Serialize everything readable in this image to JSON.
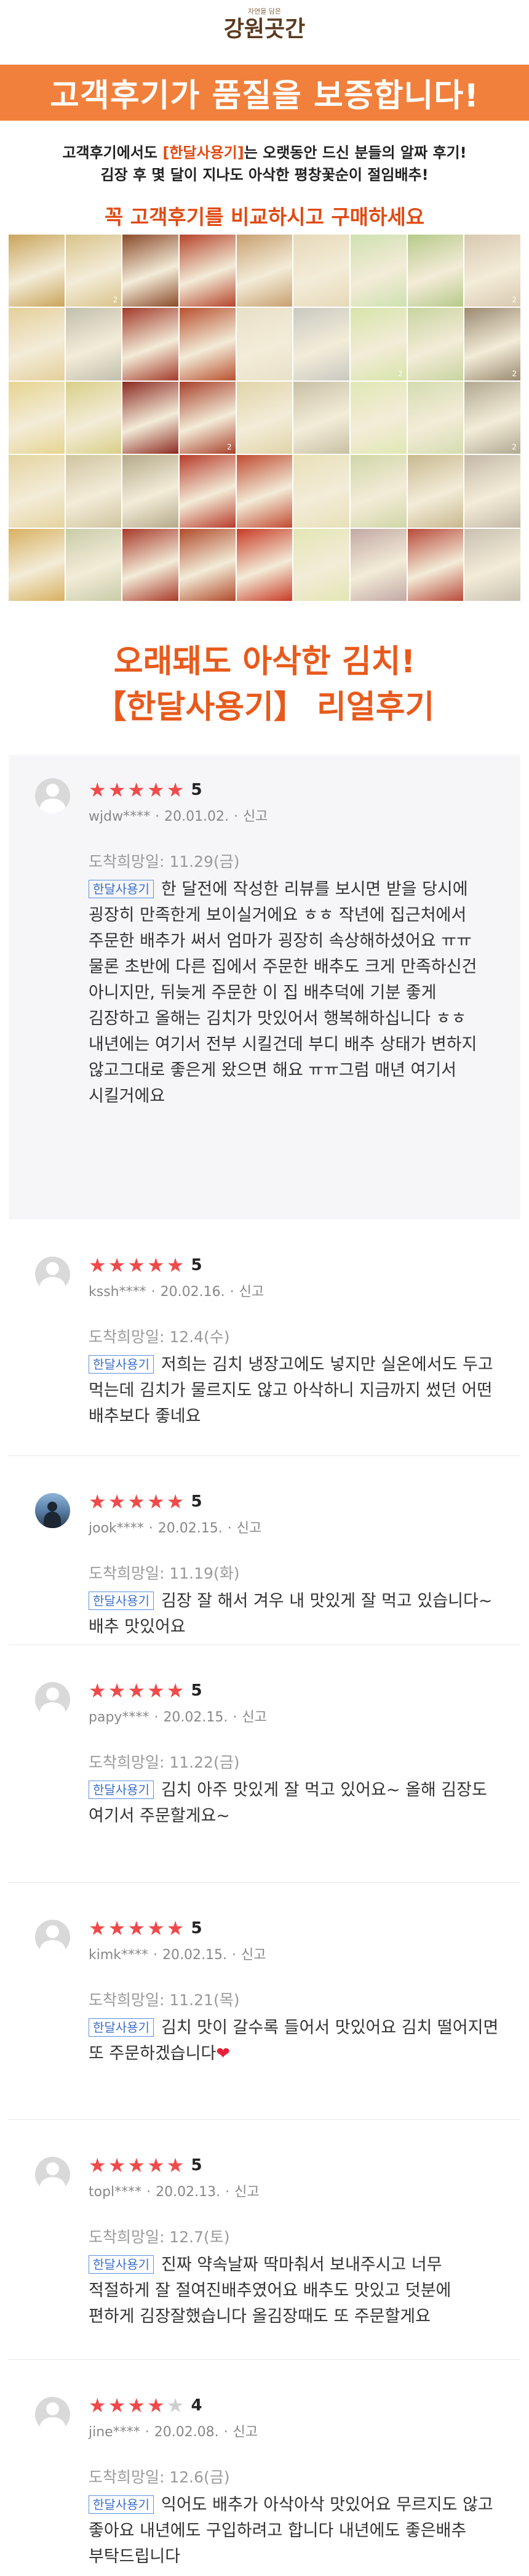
{
  "logo": {
    "subtitle": "자연을 담은",
    "title": "강원곳간"
  },
  "banner": {
    "title": "고객후기가 품질을 보증합니다!"
  },
  "intro": {
    "line1_pre": "고객후기에서도 ",
    "line1_highlight": "[한달사용기]",
    "line1_post": "는 오랫동안 드신 분들의 알짜 후기!",
    "line2": "김장 후 몇 달이 지나도 아삭한 평창꽃순이 절임배추!",
    "cta": "꼭 고객후기를 비교하시고 구매하세요"
  },
  "photo_grid": {
    "colors": [
      "#c9a45a",
      "#d9c38a",
      "#8a4a2a",
      "#b5442a",
      "#c8a070",
      "#e6d9b8",
      "#cfe0b0",
      "#b7c98a",
      "#d8c8b0",
      "#e4cf9a",
      "#c2bfae",
      "#a33a2a",
      "#b8502e",
      "#e8e0c8",
      "#c9c9c2",
      "#d6e4a8",
      "#c8d4a0",
      "#9a8a70",
      "#e6d490",
      "#d9cf88",
      "#8c2a22",
      "#a8402a",
      "#e0d4a8",
      "#c8c0a4",
      "#e0e8b4",
      "#d4dcb0",
      "#b0a890",
      "#e4d4a0",
      "#d0c4a0",
      "#b4a98a",
      "#b83a2a",
      "#c04a30",
      "#e8e0b8",
      "#cfd6a8",
      "#c8b890",
      "#c4b8a8",
      "#d8b060",
      "#c8cca8",
      "#a83a2a",
      "#b04a2a",
      "#c83a24",
      "#e2e6b4",
      "#c2a8a4",
      "#b84a3a",
      "#c9c0b0"
    ],
    "counts": [
      "",
      "2",
      "",
      "",
      "",
      "",
      "",
      "",
      "2",
      "",
      "",
      "",
      "",
      "",
      "",
      "2",
      "",
      "2",
      "",
      "",
      "",
      "2",
      "",
      "",
      "",
      "",
      "2",
      "",
      "",
      "",
      "",
      "",
      "",
      "",
      "",
      "",
      "",
      "",
      "",
      "",
      "",
      "",
      "",
      "",
      ""
    ]
  },
  "headline": {
    "line1": "오래돼도 아삭한 김치!",
    "line2": "【한달사용기】 리얼후기"
  },
  "review_labels": {
    "report": "신고",
    "tag": "한달사용기",
    "purchase_prefix": "도착희망일: "
  },
  "reviews": [
    {
      "rating": 5,
      "score": "5",
      "user": "wjdw****",
      "date": "20.01.02.",
      "arrival": "11.29(금)",
      "text": "한 달전에 작성한 리뷰를 보시면 받을 당시에 굉장히 만족한게 보이실거에요 ㅎㅎ 작년에 집근처에서 주문한 배추가 써서 엄마가 굉장히 속상해하셨어요 ㅠㅠ 물론 초반에 다른 집에서 주문한 배추도 크게 만족하신건 아니지만, 뒤늦게 주문한 이 집 배추덕에 기분 좋게 김장하고 올해는 김치가 맛있어서 행복해하십니다 ㅎㅎ 내년에는 여기서 전부 시킬건데 부디 배추 상태가 변하지 않고그대로 좋은게 왔으면 해요 ㅠㅠ그럼 매년 여기서 시킬거에요"
    },
    {
      "rating": 5,
      "score": "5",
      "user": "kssh****",
      "date": "20.02.16.",
      "arrival": "12.4(수)",
      "text": "저희는   김치 냉장고에도  넣지만   실온에서도 두고  먹는데  김치가  물르지도  않고  아삭하니  지금까지  썼던 어떤  배추보다  좋네요"
    },
    {
      "rating": 5,
      "score": "5",
      "user": "jook****",
      "date": "20.02.15.",
      "arrival": "11.19(화)",
      "text": "김장 잘 해서 겨우 내 맛있게 잘 먹고 있습니다~배추 맛있어요"
    },
    {
      "rating": 5,
      "score": "5",
      "user": "papy****",
      "date": "20.02.15.",
      "arrival": "11.22(금)",
      "text": "김치 아주 맛있게 잘 먹고 있어요~ 올해 김장도 여기서 주문할게요~"
    },
    {
      "rating": 5,
      "score": "5",
      "user": "kimk****",
      "date": "20.02.15.",
      "arrival": "11.21(목)",
      "text": "김치 맛이 갈수록 들어서 맛있어요 김치 떨어지면 또 주문하겠습니다"
    },
    {
      "rating": 5,
      "score": "5",
      "user": "topl****",
      "date": "20.02.13.",
      "arrival": "12.7(토)",
      "text": "진짜 약속날짜 딱마춰서 보내주시고 너무 적절하게 잘 절여진배추였어요 배추도 맛있고 덧분에 편하게 김장잘했습니다 올김장때도 또 주문할게요"
    },
    {
      "rating": 4,
      "score": "4",
      "user": "jine****",
      "date": "20.02.08.",
      "arrival": "12.6(금)",
      "text": "익어도 배추가 아삭아삭 맛있어요 무르지도 않고 좋아요 내년에도 구입하려고 합니다 내년에도 좋은배추 부탁드립니다"
    }
  ]
}
